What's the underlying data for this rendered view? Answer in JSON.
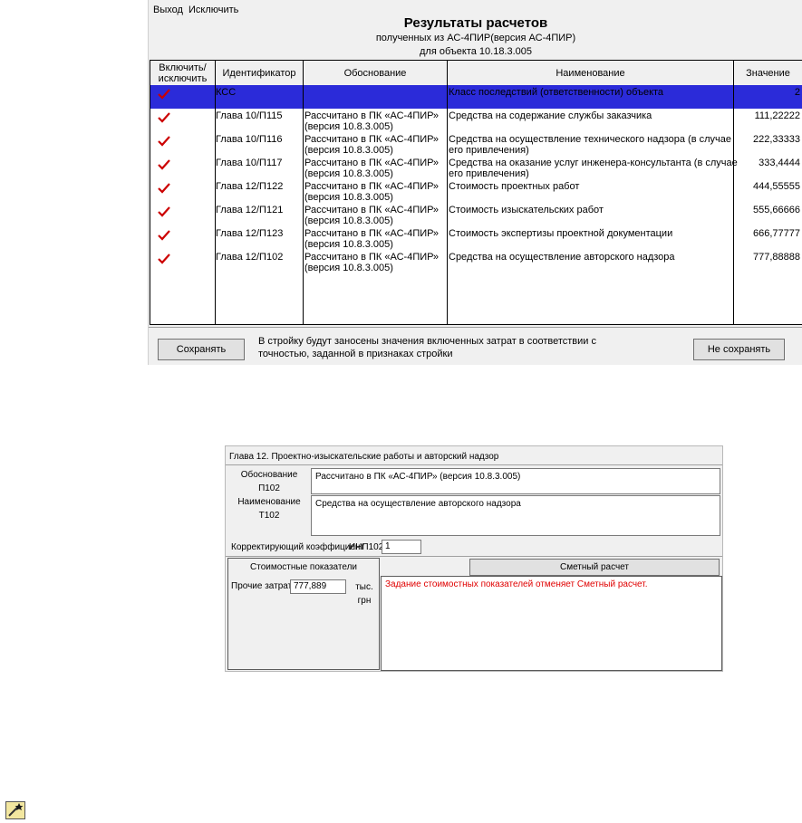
{
  "menu": {
    "items": [
      "Выход",
      "Исключить"
    ]
  },
  "results": {
    "title": "Результаты расчетов",
    "subtitle": "полученных из АС-4ПИР(версия АС-4ПИР)",
    "object_line": "для объекта 10.18.3.005",
    "columns": [
      "Включить/ исключить",
      "Идентификатор",
      "Обоснование",
      "Наименование",
      "Значение"
    ],
    "rows": [
      {
        "id": "КСС",
        "basis": [
          "",
          ""
        ],
        "name": [
          "Класс последствий (ответственности) объекта",
          ""
        ],
        "value": "2",
        "checked": true,
        "selected": true
      },
      {
        "id": "Глава 10/П115",
        "basis": [
          "Рассчитано в ПК «АС-4ПИР»",
          "(версия 10.8.3.005)"
        ],
        "name": [
          "Средства на содержание службы заказчика",
          ""
        ],
        "value": "111,22222",
        "checked": true,
        "selected": false
      },
      {
        "id": "Глава 10/П116",
        "basis": [
          "Рассчитано в ПК «АС-4ПИР»",
          "(версия 10.8.3.005)"
        ],
        "name": [
          "Средства на осуществление технического надзора  (в случае",
          "его привлечения)"
        ],
        "value": "222,33333",
        "checked": true,
        "selected": false
      },
      {
        "id": "Глава 10/П117",
        "basis": [
          "Рассчитано в ПК «АС-4ПИР»",
          "(версия 10.8.3.005)"
        ],
        "name": [
          "Средства на оказание услуг инженера-консультанта  (в случае",
          "его привлечения)"
        ],
        "value": "333,4444",
        "checked": true,
        "selected": false
      },
      {
        "id": "Глава 12/П122",
        "basis": [
          "Рассчитано в ПК «АС-4ПИР»",
          "(версия 10.8.3.005)"
        ],
        "name": [
          "Стоимость проектных работ",
          ""
        ],
        "value": "444,55555",
        "checked": true,
        "selected": false
      },
      {
        "id": "Глава 12/П121",
        "basis": [
          "Рассчитано в ПК «АС-4ПИР»",
          "(версия 10.8.3.005)"
        ],
        "name": [
          "Стоимость изыскательских работ",
          ""
        ],
        "value": "555,66666",
        "checked": true,
        "selected": false
      },
      {
        "id": "Глава 12/П123",
        "basis": [
          "Рассчитано в ПК «АС-4ПИР»",
          "(версия 10.8.3.005)"
        ],
        "name": [
          "Стоимость экспертизы проектной документации",
          ""
        ],
        "value": "666,77777",
        "checked": true,
        "selected": false
      },
      {
        "id": "Глава 12/П102",
        "basis": [
          "Рассчитано в ПК «АС-4ПИР»",
          "(версия 10.8.3.005)"
        ],
        "name": [
          "Средства на осуществление авторского надзора",
          ""
        ],
        "value": "777,88888",
        "checked": true,
        "selected": false
      }
    ],
    "footer": {
      "save_label": "Сохранять",
      "nosave_label": "Не сохранять",
      "note": "В стройку будут заносены значения включенных затрат в соответствии с точностью, заданной в признаках стройки"
    }
  },
  "dialog": {
    "title": "Глава 12. Проектно-изыскательские работы и авторский надзор",
    "basis_label": "Обоснование",
    "basis_code": "П102",
    "basis_value": "Рассчитано в ПК «АС-4ПИР» (версия 10.8.3.005)",
    "name_label": "Наименование",
    "name_code": "Т102",
    "name_value": "Средства на осуществление авторского надзора",
    "coef_label": "Корректирующий коэффициент",
    "coef_code": "ИНП102",
    "coef_value": "1",
    "cost_panel_title": "Стоимостные показатели",
    "other_costs_label": "Прочие затраты",
    "other_costs_value": "777,889",
    "unit": "тыс. грн",
    "estimate_button": "Сметный расчет",
    "message": "Задание стоимостных показателей отменяет Сметный расчет."
  },
  "colors": {
    "selection": "#2b2bd9",
    "check": "#cc0000",
    "warning": "#e00000"
  },
  "icons": [
    "checkmark-icon",
    "wand-icon"
  ]
}
